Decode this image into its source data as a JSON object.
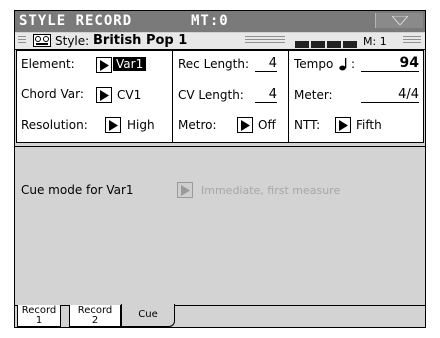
{
  "title": {
    "text": "STYLE RECORD",
    "mt": "MT:0"
  },
  "style_bar": {
    "label": "Style:",
    "name": "British Pop 1",
    "measure": "M: 1"
  },
  "params": {
    "element": {
      "label": "Element:",
      "value": "Var1"
    },
    "chord_var": {
      "label": "Chord Var:",
      "value": "CV1"
    },
    "resolution": {
      "label": "Resolution:",
      "value": "High"
    },
    "rec_length": {
      "label": "Rec Length:",
      "value": "4"
    },
    "cv_length": {
      "label": "CV Length:",
      "value": "4"
    },
    "metro": {
      "label": "Metro:",
      "value": "Off"
    },
    "tempo": {
      "label": "Tempo",
      "value": "94"
    },
    "meter": {
      "label": "Meter:",
      "value": "4/4"
    },
    "ntt": {
      "label": "NTT:",
      "value": "Fifth"
    }
  },
  "cue": {
    "label": "Cue mode for Var1",
    "value": "Immediate, first measure"
  },
  "tabs": [
    {
      "line1": "Record",
      "line2": "1"
    },
    {
      "line1": "Record",
      "line2": "2"
    },
    {
      "line1": "Cue",
      "line2": ""
    }
  ],
  "icons": {
    "menu": "triangle-down-icon",
    "style": "tape-icon",
    "popup": "triangle-right-icon",
    "tempo": "quarter-note-icon"
  }
}
